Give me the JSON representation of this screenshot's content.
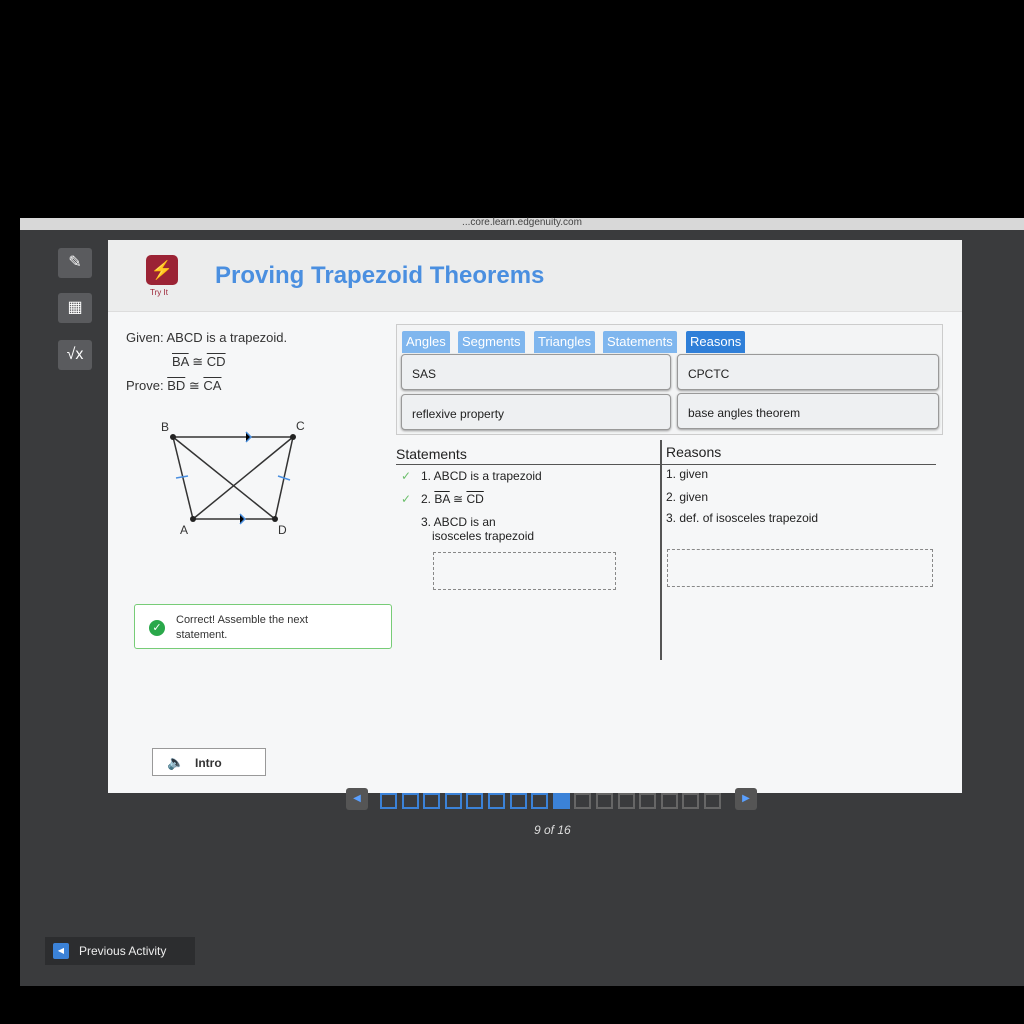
{
  "browser": {
    "url": "...core.learn.edgenuity.com"
  },
  "tools": [
    {
      "icon": "pencil-icon"
    },
    {
      "icon": "calculator-icon"
    },
    {
      "icon": "formula-icon"
    }
  ],
  "header": {
    "badge": "Try It",
    "title": "Proving Trapezoid Theorems"
  },
  "problem": {
    "given_label": "Given:",
    "given1": "ABCD is a trapezoid.",
    "given2_a": "BA",
    "cong": "≅",
    "given2_b": "CD",
    "prove_label": "Prove:",
    "prove_a": "BD",
    "prove_b": "CA"
  },
  "diagram": {
    "vertices": [
      "B",
      "C",
      "A",
      "D"
    ]
  },
  "bank": {
    "tabs": [
      "Angles",
      "Segments",
      "Triangles",
      "Statements",
      "Reasons"
    ],
    "active_tab": "Reasons",
    "chips": [
      "SAS",
      "CPCTC",
      "reflexive property",
      "base angles theorem"
    ]
  },
  "proof": {
    "statements_header": "Statements",
    "reasons_header": "Reasons",
    "statements": [
      "1. ABCD is a trapezoid",
      "2. ",
      "3. ABCD is an",
      "isosceles trapezoid"
    ],
    "s2_a": "BA",
    "s2_b": "CD",
    "reasons": [
      "1. given",
      "2. given",
      "3. def. of isosceles trapezoid"
    ],
    "check": "✓"
  },
  "feedback": {
    "text": "Correct! Assemble the next statement."
  },
  "intro": {
    "label": "Intro"
  },
  "pager": {
    "current": 9,
    "total": 16,
    "text": "9 of 16"
  },
  "footer": {
    "previous": "Previous Activity"
  },
  "colors": {
    "accent": "#3b82d8",
    "title": "#4a8fe0",
    "logo": "#9b2335",
    "success": "#2aa84a"
  }
}
